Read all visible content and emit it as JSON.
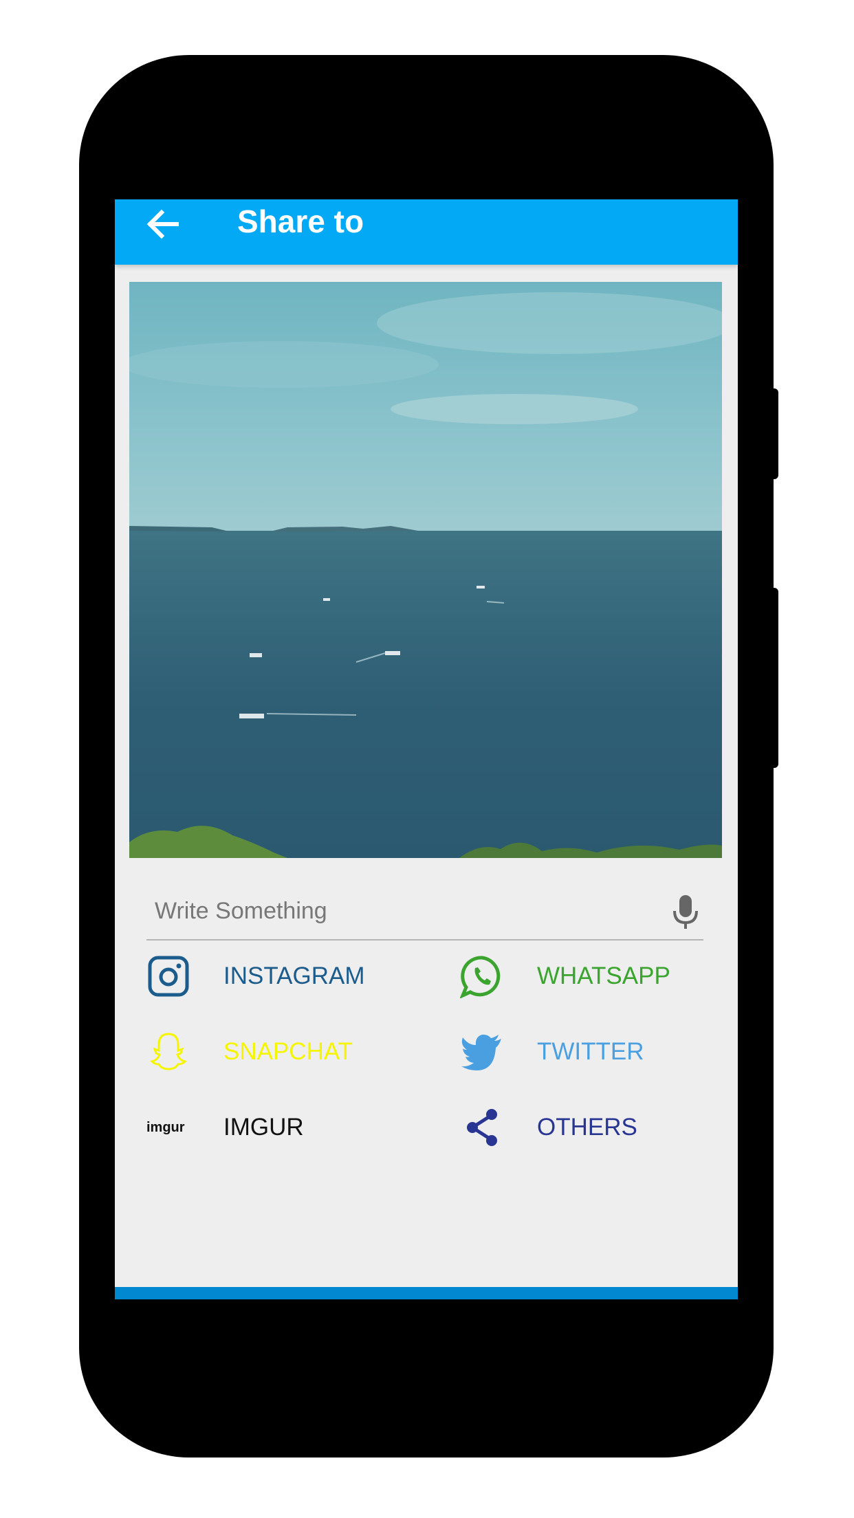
{
  "appbar": {
    "title": "Share to",
    "back_icon": "arrow-left-icon",
    "background": "#03a9f4"
  },
  "preview": {
    "content": "sea-landscape-photo"
  },
  "caption": {
    "placeholder": "Write Something",
    "value": "",
    "icon": "microphone-icon"
  },
  "share_options": [
    {
      "label": "INSTAGRAM",
      "icon": "instagram-icon",
      "color": "#1c5c8c"
    },
    {
      "label": "WHATSAPP",
      "icon": "whatsapp-icon",
      "color": "#3aa42f"
    },
    {
      "label": "SNAPCHAT",
      "icon": "snapchat-icon",
      "color": "#f5f500"
    },
    {
      "label": "TWITTER",
      "icon": "twitter-icon",
      "color": "#4a9fe0"
    },
    {
      "label": "IMGUR",
      "icon": "imgur-logo",
      "icon_text": "imgur",
      "color": "#111111"
    },
    {
      "label": "OTHERS",
      "icon": "share-icon",
      "color": "#283593"
    }
  ]
}
